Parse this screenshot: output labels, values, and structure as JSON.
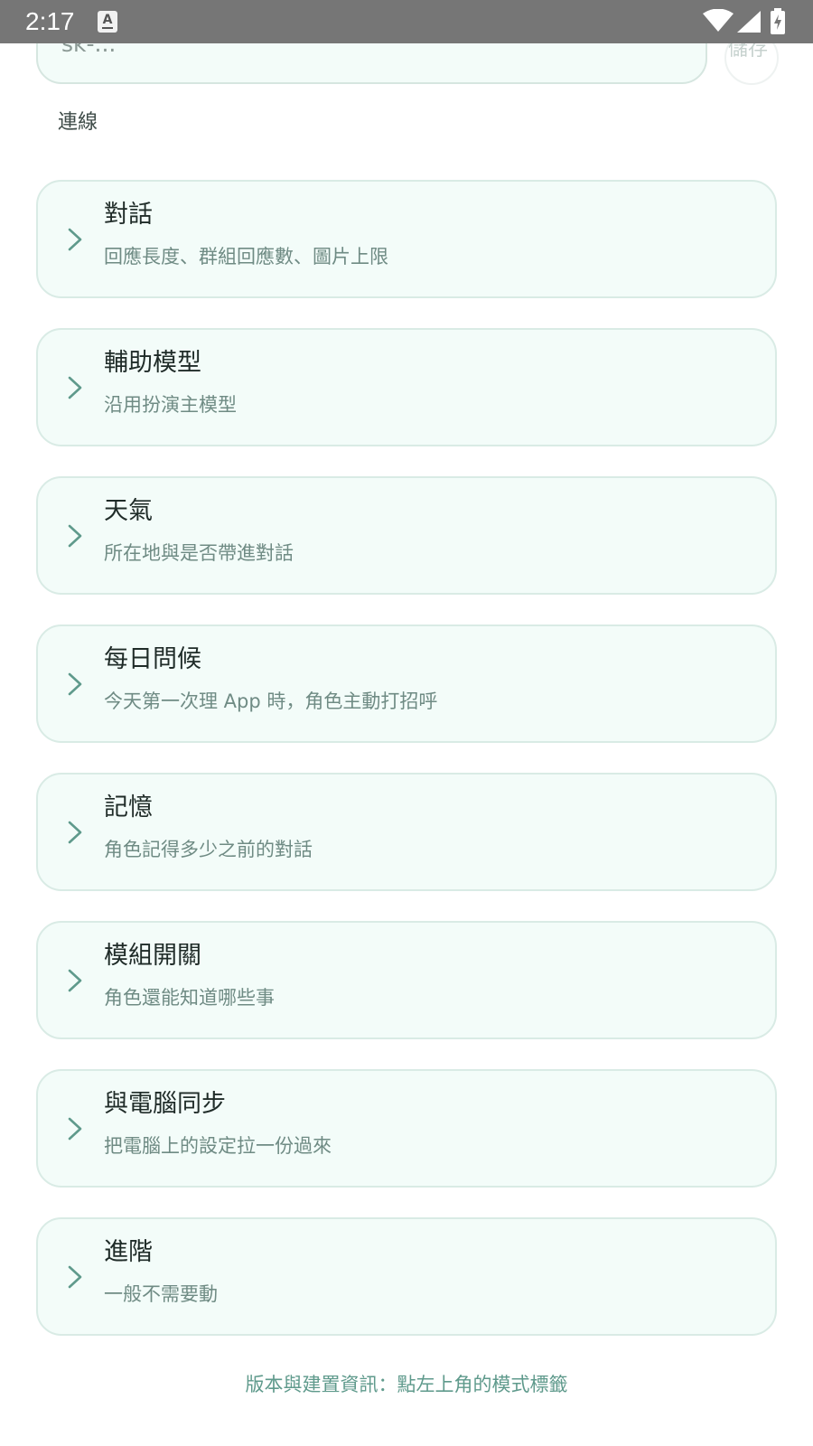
{
  "status_bar": {
    "time": "2:17",
    "keyboard_indicator": "A"
  },
  "connection": {
    "api_key_value": "sk-...",
    "save_label": "儲存",
    "section_label": "連線"
  },
  "settings": [
    {
      "title": "對話",
      "subtitle": "回應長度、群組回應數、圖片上限",
      "icon": "chevron-right-icon"
    },
    {
      "title": "輔助模型",
      "subtitle": "沿用扮演主模型",
      "icon": "chevron-right-icon"
    },
    {
      "title": "天氣",
      "subtitle": "所在地與是否帶進對話",
      "icon": "chevron-right-icon"
    },
    {
      "title": "每日問候",
      "subtitle": "今天第一次理 App 時，角色主動打招呼",
      "icon": "chevron-right-icon"
    },
    {
      "title": "記憶",
      "subtitle": "角色記得多少之前的對話",
      "icon": "chevron-right-icon"
    },
    {
      "title": "模組開關",
      "subtitle": "角色還能知道哪些事",
      "icon": "chevron-right-icon"
    },
    {
      "title": "與電腦同步",
      "subtitle": "把電腦上的設定拉一份過來",
      "icon": "chevron-right-icon"
    },
    {
      "title": "進階",
      "subtitle": "一般不需要動",
      "icon": "chevron-right-icon"
    }
  ],
  "footer": {
    "version_note": "版本與建置資訊：點左上角的模式標籤"
  },
  "colors": {
    "accent": "#5f9a8c",
    "card_background": "#f3fcf9",
    "card_border": "#d9ebe5",
    "status_bar": "#767676"
  }
}
